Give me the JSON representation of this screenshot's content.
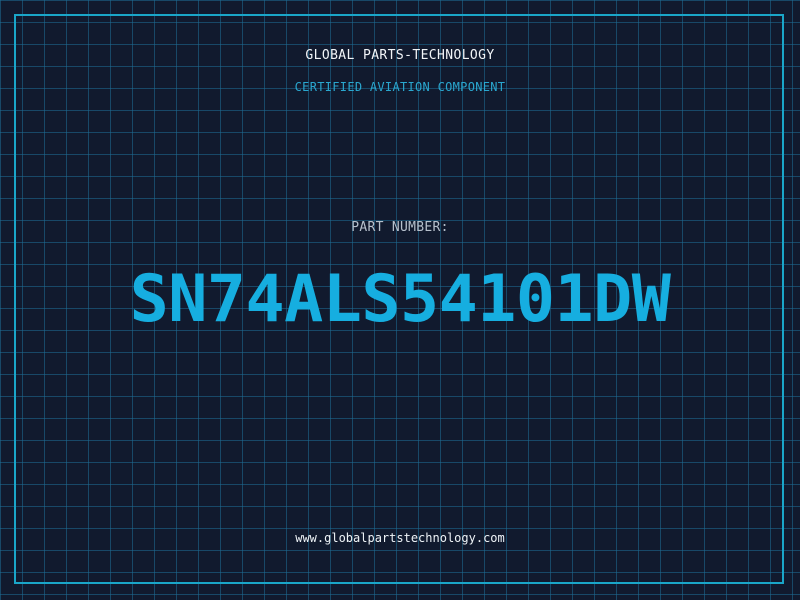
{
  "header": {
    "company": "GLOBAL PARTS-TECHNOLOGY",
    "subtitle": "CERTIFIED AVIATION COMPONENT"
  },
  "part": {
    "label": "PART NUMBER:",
    "number": "SN74ALS54101DW"
  },
  "footer": {
    "website": "www.globalpartstechnology.com"
  },
  "colors": {
    "background": "#111a2e",
    "grid": "#1e6e96",
    "frame": "#1aa6c8",
    "accent": "#16aee0",
    "subtitle": "#2aa7cf",
    "label": "#b6c0cc",
    "text": "#f2f5f8"
  }
}
